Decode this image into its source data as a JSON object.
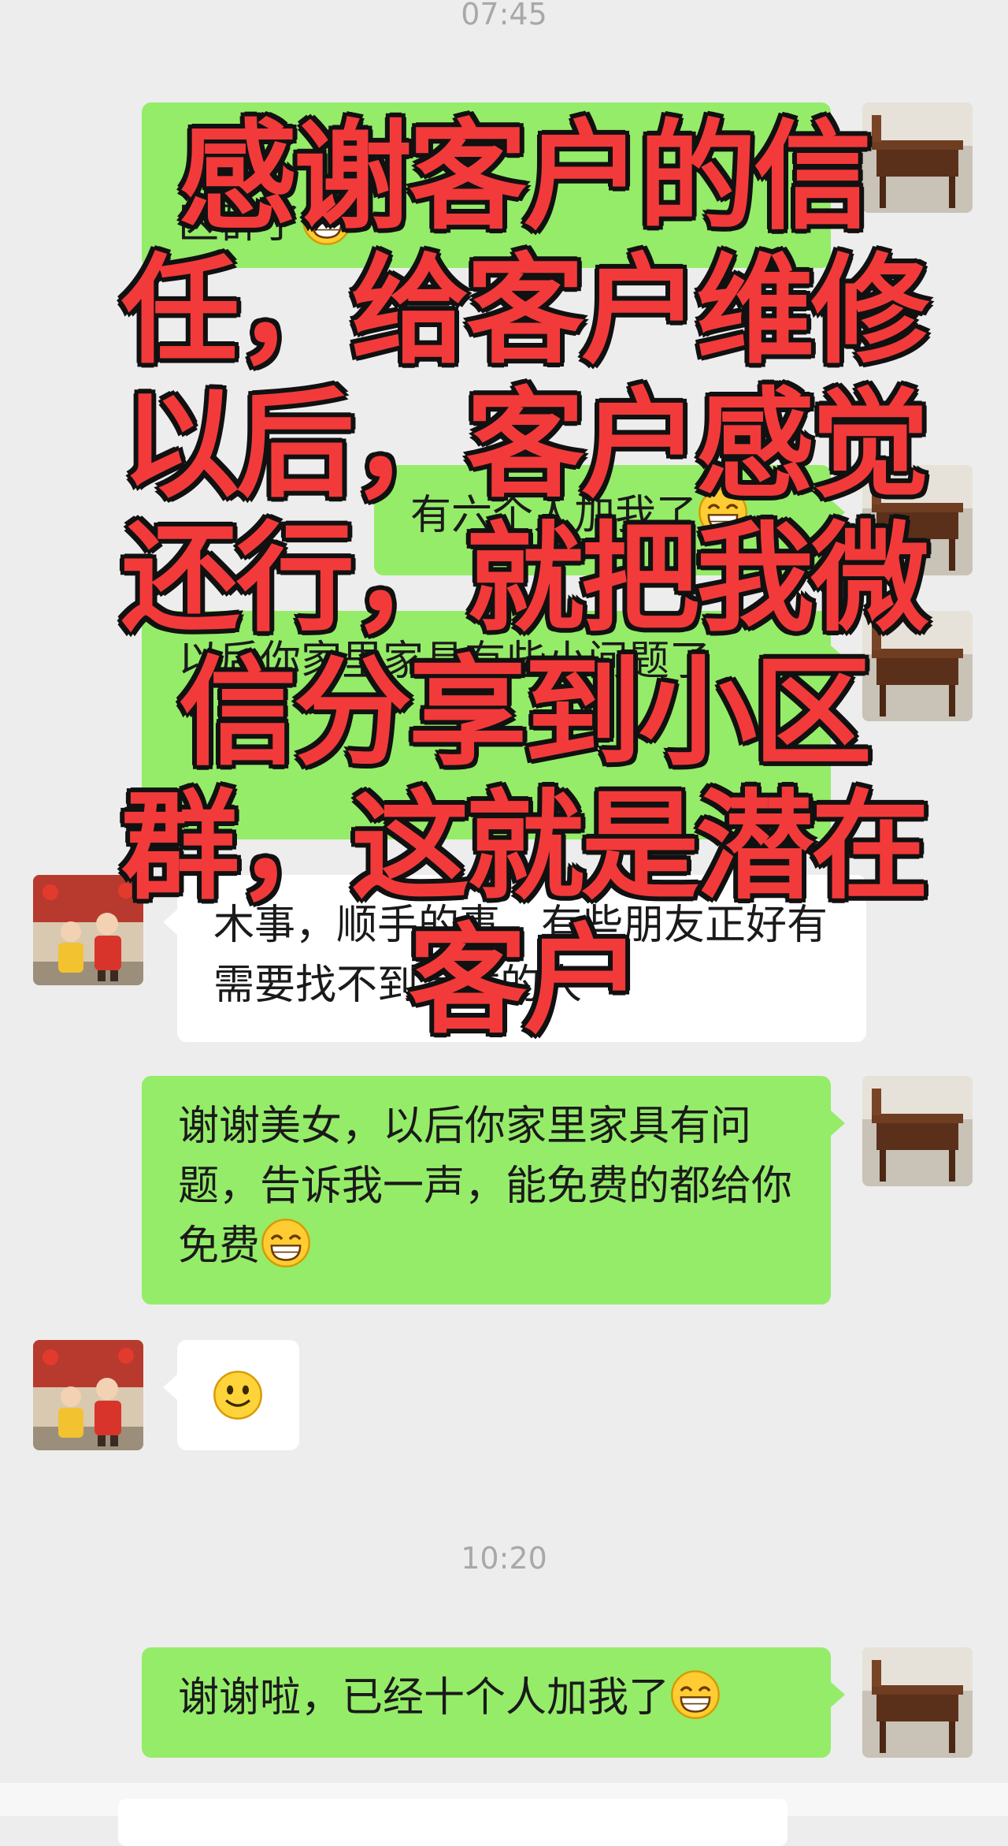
{
  "chat": {
    "timestamp_top": "07:45",
    "overlay_caption": "感谢客户的信任，给客户维修以后，客户感觉还行，就把我微信分享到小区群，这就是潜在客户",
    "messages": [
      {
        "from": "me",
        "text": "区群了"
      },
      {
        "from": "me",
        "text": "有六个人加我了"
      },
      {
        "from": "me",
        "text": "以后你家里家具有些小问题了"
      },
      {
        "from": "other",
        "text": "木事，顺手的事，有些朋友正好有需要找不到合适的人"
      },
      {
        "from": "me",
        "text": "谢谢美女，以后你家里家具有问题，告诉我一声，能免费的都给你免费"
      },
      {
        "from": "other",
        "text": ""
      },
      {
        "from": "me",
        "text": "谢谢啦，已经十个人加我了"
      }
    ],
    "timestamp_bottom": "10:20"
  },
  "icons": {
    "grin": "grin-emoji-icon",
    "smile": "smile-emoji-icon",
    "my_avatar": "desk-photo-avatar",
    "other_avatar": "kids-photo-avatar"
  },
  "colors": {
    "my_bubble": "#95ec69",
    "other_bubble": "#ffffff",
    "background": "#ededed",
    "overlay_text": "#f23a3a"
  }
}
